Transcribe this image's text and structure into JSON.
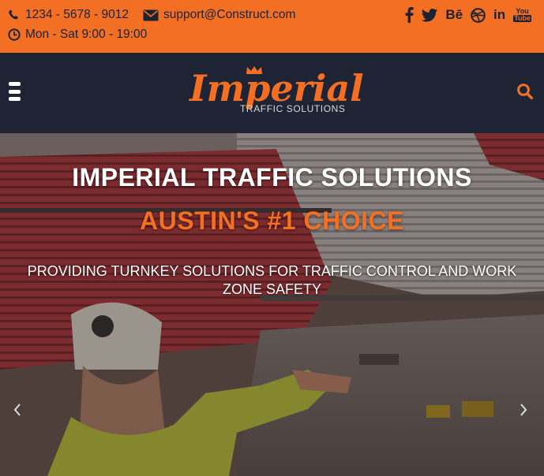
{
  "topbar": {
    "phone": "1234 - 5678 - 9012",
    "email": "support@Construct.com",
    "hours": "Mon - Sat 9:00 - 19:00"
  },
  "social": {
    "behance_label": "Bē",
    "linkedin_label": "in",
    "youtube_you": "You",
    "youtube_tube": "Tube",
    "icons": [
      "facebook-icon",
      "twitter-icon",
      "behance-icon",
      "dribbble-icon",
      "linkedin-icon",
      "youtube-icon"
    ]
  },
  "navbar": {
    "logo_brand": "Imperial",
    "logo_sub": "TRAFFIC SOLUTIONS"
  },
  "hero": {
    "title": "IMPERIAL TRAFFIC SOLUTIONS",
    "subtitle": "AUSTIN'S #1 CHOICE",
    "description": "PROVIDING TURNKEY SOLUTIONS FOR TRAFFIC CONTROL AND WORK ZONE SAFETY"
  },
  "colors": {
    "accent": "#f26f24",
    "navbar_bg": "#1e2433",
    "topbar_text": "#1c2230"
  }
}
